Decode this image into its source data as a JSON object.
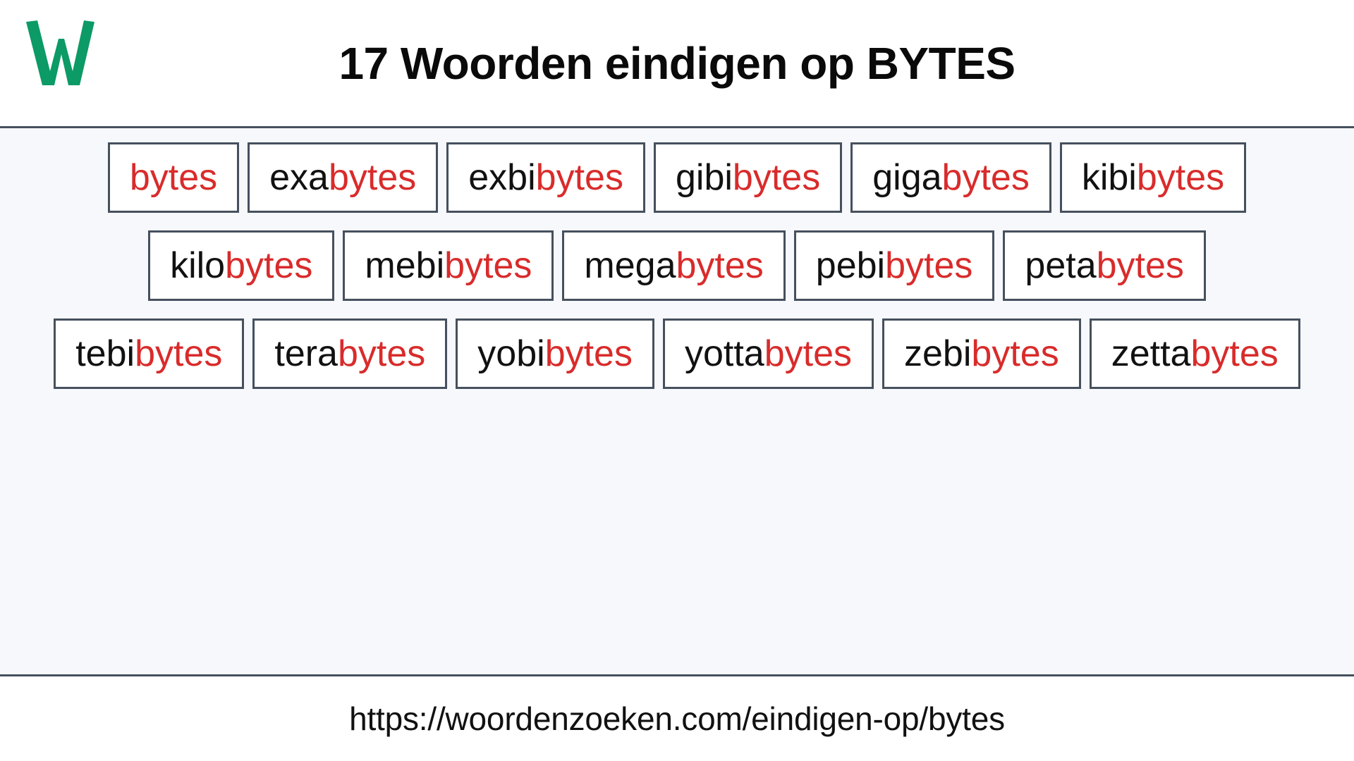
{
  "header": {
    "logo_letter": "W",
    "logo_icon": "w-logo-icon",
    "logo_color": "#0c9a66",
    "title": "17 Woorden eindigen op BYTES"
  },
  "theme": {
    "page_background": "#ffffff",
    "content_background": "#f6f8fb",
    "border_color": "#46505e",
    "box_background": "#ffffff",
    "prefix_color": "#111111",
    "suffix_color": "#d92b2b",
    "accent_green": "#0c9a66"
  },
  "main": {
    "highlight_suffix": "bytes",
    "rows": [
      {
        "words": [
          {
            "prefix": "",
            "suffix": "bytes",
            "full": "bytes"
          },
          {
            "prefix": "exa",
            "suffix": "bytes",
            "full": "exabytes"
          },
          {
            "prefix": "exbi",
            "suffix": "bytes",
            "full": "exbibytes"
          },
          {
            "prefix": "gibi",
            "suffix": "bytes",
            "full": "gibibytes"
          },
          {
            "prefix": "giga",
            "suffix": "bytes",
            "full": "gigabytes"
          },
          {
            "prefix": "kibi",
            "suffix": "bytes",
            "full": "kibibytes"
          }
        ]
      },
      {
        "words": [
          {
            "prefix": "kilo",
            "suffix": "bytes",
            "full": "kilobytes"
          },
          {
            "prefix": "mebi",
            "suffix": "bytes",
            "full": "mebibytes"
          },
          {
            "prefix": "mega",
            "suffix": "bytes",
            "full": "megabytes"
          },
          {
            "prefix": "pebi",
            "suffix": "bytes",
            "full": "pebibytes"
          },
          {
            "prefix": "peta",
            "suffix": "bytes",
            "full": "petabytes"
          }
        ]
      },
      {
        "words": [
          {
            "prefix": "tebi",
            "suffix": "bytes",
            "full": "tebibytes"
          },
          {
            "prefix": "tera",
            "suffix": "bytes",
            "full": "terabytes"
          },
          {
            "prefix": "yobi",
            "suffix": "bytes",
            "full": "yobibytes"
          },
          {
            "prefix": "yotta",
            "suffix": "bytes",
            "full": "yottabytes"
          },
          {
            "prefix": "zebi",
            "suffix": "bytes",
            "full": "zebibytes"
          },
          {
            "prefix": "zetta",
            "suffix": "bytes",
            "full": "zettabytes"
          }
        ]
      }
    ]
  },
  "footer": {
    "url": "https://woordenzoeken.com/eindigen-op/bytes"
  }
}
